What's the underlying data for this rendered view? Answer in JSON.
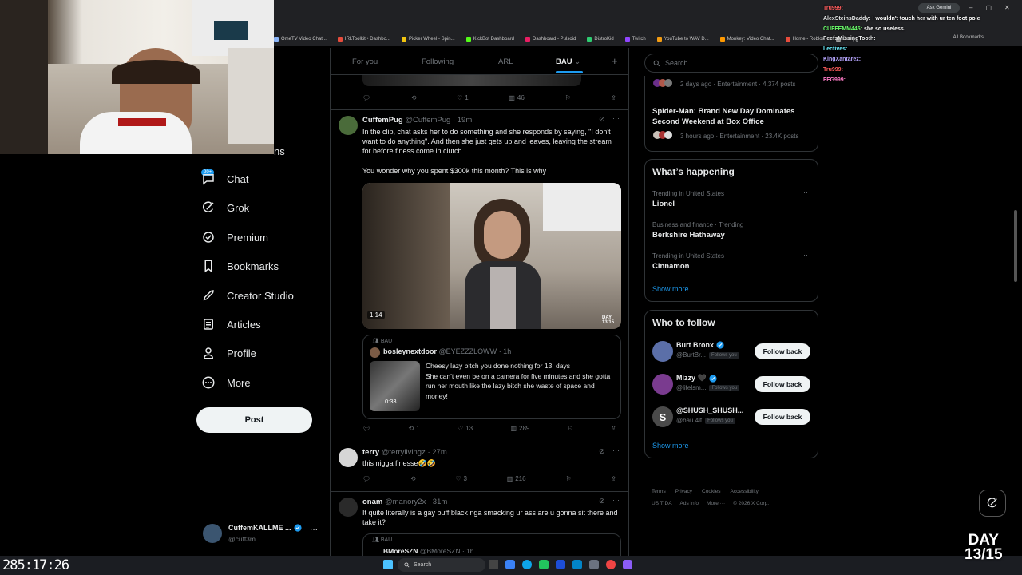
{
  "browser": {
    "bookmarks": [
      "OmeTV Video Chat...",
      "IRLToolkit • Dashbo...",
      "Picker Wheel - Spin...",
      "KickBot Dashboard",
      "Dashboard - Pulsoid",
      "DistroKid",
      "Twitch",
      "YouTube to WAV D...",
      "Monkey: Video Chat...",
      "Home - Roblox",
      "Bau |"
    ],
    "all_bookmarks": "All Bookmarks",
    "ask_gemini": "Ask Gemini"
  },
  "stream_chat": [
    {
      "user": "Tru999:",
      "msg": "",
      "color": "#ff5d5d"
    },
    {
      "user": "AlexSteinsDaddy:",
      "msg": "I wouldn't touch her with ur ten foot pole",
      "color": "#e7e9ea"
    },
    {
      "user": "CUFFEMM445:",
      "msg": "she so useless.",
      "color": "#6cff6c"
    },
    {
      "user": "FeefsMissingTooth:",
      "msg": "",
      "color": "#e7e9ea"
    },
    {
      "user": "Lectives:",
      "msg": "",
      "color": "#6cf0ff"
    },
    {
      "user": "KingXantarez:",
      "msg": "",
      "color": "#b7a6ff"
    },
    {
      "user": "Tru999:",
      "msg": "",
      "color": "#ff5d5d"
    },
    {
      "user": "FFG999:",
      "msg": "",
      "color": "#ff7cc8"
    }
  ],
  "nav": {
    "partial_label": "ns",
    "chat_badge": "20+",
    "items": [
      {
        "label": "Chat",
        "icon": "chat-icon"
      },
      {
        "label": "Grok",
        "icon": "grok-icon"
      },
      {
        "label": "Premium",
        "icon": "premium-icon"
      },
      {
        "label": "Bookmarks",
        "icon": "bookmark-icon"
      },
      {
        "label": "Creator Studio",
        "icon": "rocket-icon"
      },
      {
        "label": "Articles",
        "icon": "article-icon"
      },
      {
        "label": "Profile",
        "icon": "profile-icon"
      },
      {
        "label": "More",
        "icon": "more-circle-icon"
      }
    ],
    "post_label": "Post",
    "account": {
      "name": "CuffemKALLME ...",
      "handle": "@cuff3m"
    }
  },
  "tabs": [
    "For you",
    "Following",
    "ARL",
    "BAU"
  ],
  "prev_tweet": {
    "likes": "1",
    "views": "46"
  },
  "tweets": [
    {
      "name": "CuffemPug",
      "handle": "@CuffemPug",
      "time": "· 19m",
      "text": "In the clip, chat asks her to do something and she responds by saying, \"I don't want to do anything\". And then she just gets up and leaves, leaving the stream for before finess come in clutch",
      "text2": "You wonder why you spent $300k this month? This is why",
      "video_duration": "1:14",
      "video_daybadge": "DAY\n13/15",
      "quote": {
        "community": "BAU",
        "name": "bosleynextdoor",
        "handle": "@EYEZZZLOWW",
        "time": "· 1h",
        "text": "Cheesy lazy bitch you done nothing for 13  days\nShe can't even be on a camera for five minutes and she gotta run her mouth like the lazy bitch she waste of space and money!",
        "duration": "0:33"
      },
      "replies": "",
      "reposts": "1",
      "likes": "13",
      "views": "289"
    },
    {
      "name": "terry",
      "handle": "@terrylivingz",
      "time": "· 27m",
      "text": "this nigga finesse🤣🤣",
      "replies": "",
      "reposts": "",
      "likes": "3",
      "views": "216"
    },
    {
      "name": "onam",
      "handle": "@manory2x",
      "time": "· 31m",
      "text": "It quite literally is a gay buff black nga smacking ur ass are u gonna sit there and take it?",
      "quote_community": "BAU",
      "quote_name": "BMoreSZN",
      "quote_handle": "@BMoreSZN",
      "quote_time": "· 1h"
    }
  ],
  "search": {
    "placeholder": "Search"
  },
  "news": [
    {
      "meta": "2 days ago · Entertainment · 4,374 posts"
    },
    {
      "title": "Spider-Man: Brand New Day Dominates Second Weekend at Box Office",
      "meta": "3 hours ago · Entertainment · 23.4K posts"
    }
  ],
  "happening": {
    "title": "What’s happening",
    "trends": [
      {
        "context": "Trending in United States",
        "name": "Lionel"
      },
      {
        "context": "Business and finance · Trending",
        "name": "Berkshire Hathaway"
      },
      {
        "context": "Trending in United States",
        "name": "Cinnamon"
      }
    ],
    "show_more": "Show more"
  },
  "who_to_follow": {
    "title": "Who to follow",
    "users": [
      {
        "name": "Burt Bronx",
        "handle": "@BurtBr...",
        "badge": "Follows you",
        "button": "Follow back",
        "avatar_color": "#5b6fa8"
      },
      {
        "name": "Mizzy 🖤",
        "handle": "@lifelsm...",
        "badge": "Follows you",
        "button": "Follow back",
        "avatar_color": "#7a3b8f"
      },
      {
        "name": "@SHUSH_SHUSH...",
        "handle": "@bau.4lf",
        "badge": "Follows you",
        "button": "Follow back",
        "avatar_color": "#4a4a4a",
        "initial": "S"
      }
    ],
    "show_more": "Show more"
  },
  "footer": {
    "row1": [
      "Terms",
      "Privacy",
      "Cookies",
      "Accessibility"
    ],
    "row2": [
      "US TIDA",
      "Ads info",
      "More ···",
      "© 2026 X Corp."
    ]
  },
  "overlay": {
    "clock": "285:17:26",
    "day": "DAY\n13/15"
  },
  "taskbar": {
    "search": "Search"
  },
  "colors": {
    "accent": "#1d9bf0",
    "bg": "#000000",
    "border": "#2f3336",
    "muted": "#71767b"
  }
}
